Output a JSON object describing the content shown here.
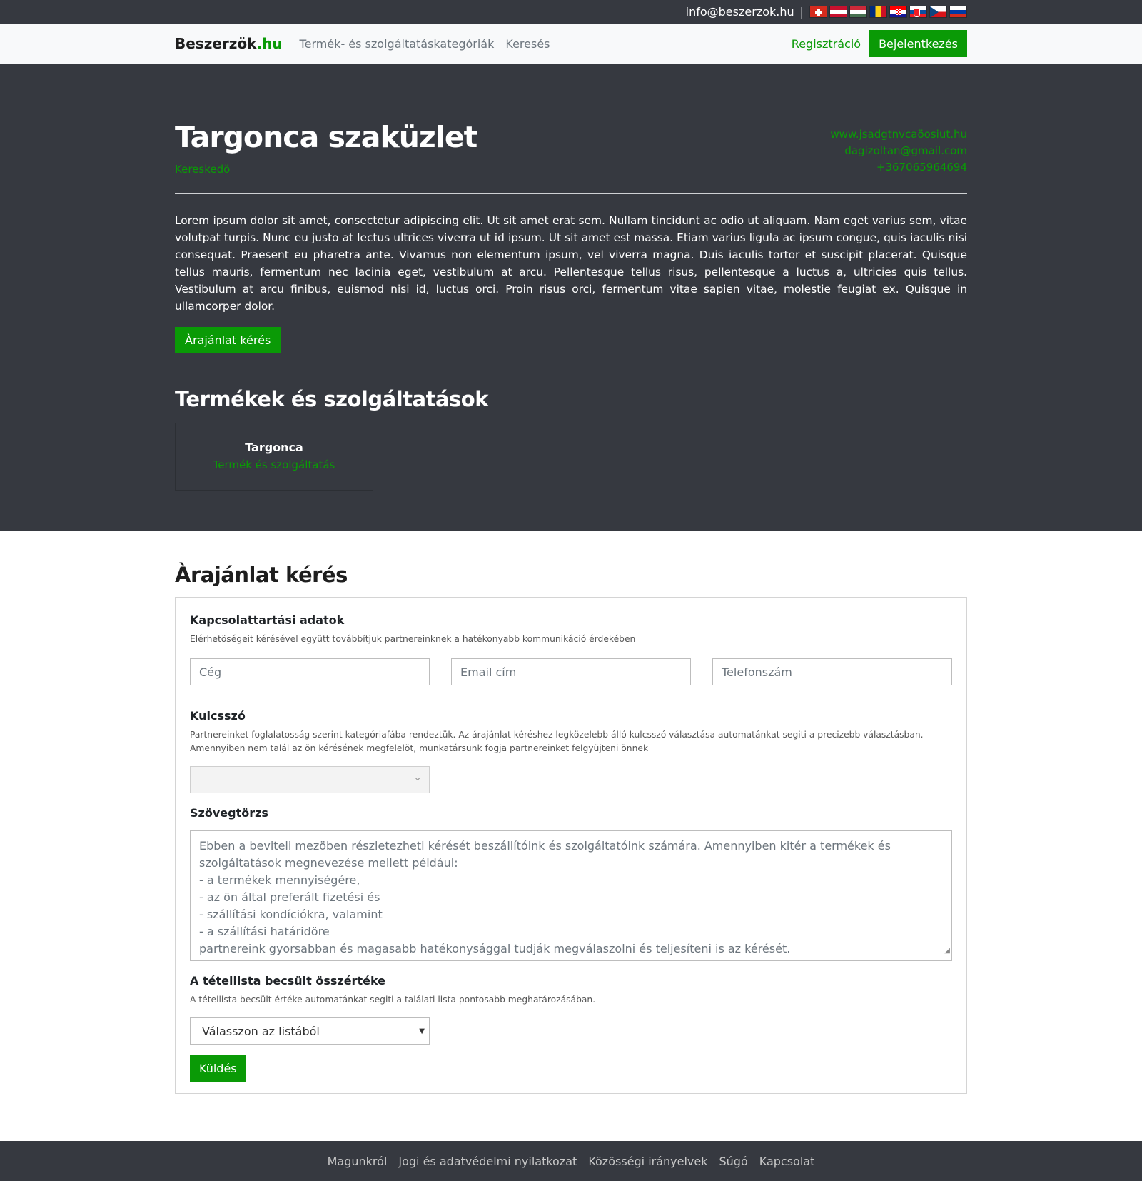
{
  "topbar": {
    "email": "info@beszerzok.hu",
    "separator": "|",
    "flags": [
      "swiss-flag-icon",
      "austria-flag-icon",
      "hungary-flag-icon",
      "romania-flag-icon",
      "croatia-flag-icon",
      "slovakia-flag-icon",
      "czech-flag-icon",
      "russia-flag-icon"
    ]
  },
  "navbar": {
    "brand_main": "Beszerzök",
    "brand_tld": ".hu",
    "links": [
      "Termék- és szolgáltatáskategóriák",
      "Keresés"
    ],
    "register": "Regisztráció",
    "login": "Bejelentkezés"
  },
  "company": {
    "name": "Targonca szaküzlet",
    "type": "Kereskedö",
    "website": "www.jsadgtnvcaöosiut.hu",
    "email": "dagizoltan@gmail.com",
    "phone": "+367065964694",
    "description": "Lorem ipsum dolor sit amet, consectetur adipiscing elit. Ut sit amet erat sem. Nullam tincidunt ac odio ut aliquam. Nam eget varius sem, vitae volutpat turpis. Nunc eu justo at lectus ultrices viverra ut id ipsum. Ut sit amet est massa. Etiam varius ligula ac ipsum congue, quis iaculis nisi consequat. Praesent eu pharetra ante. Vivamus non elementum ipsum, vel viverra magna. Duis iaculis tortor et suscipit placerat. Quisque tellus mauris, fermentum nec lacinia eget, vestibulum at arcu. Pellentesque tellus risus, pellentesque a luctus a, ultricies quis tellus. Vestibulum at arcu finibus, euismod nisi id, luctus orci. Proin risus orci, fermentum vitae sapien vitae, molestie feugiat ex. Quisque in ullamcorper dolor.",
    "quote_button": "Àrajánlat kérés"
  },
  "products": {
    "title": "Termékek és szolgáltatások",
    "items": [
      {
        "name": "Targonca",
        "category": "Termék és szolgáltatás"
      }
    ]
  },
  "form": {
    "title": "Àrajánlat kérés",
    "contact": {
      "label": "Kapcsolattartási adatok",
      "help": "Elérhetöségeit kérésével együtt továbbítjuk partnereinknek a hatékonyabb kommunikáció érdekében",
      "company_placeholder": "Cég",
      "email_placeholder": "Email cím",
      "phone_placeholder": "Telefonszám"
    },
    "keyword": {
      "label": "Kulcsszó",
      "help": "Partnereinket foglalatosság szerint kategóriafába rendeztük. Az árajánlat kéréshez legközelebb álló kulcsszó választása automatánkat segiti a precizebb választásban. Amennyiben nem talál az ön kérésének megfelelöt, munkatársunk fogja partnereinket felgyüjteni önnek",
      "value": ""
    },
    "body": {
      "label": "Szövegtörzs",
      "placeholder_lines": [
        "Ebben a beviteli mezöben részletezheti kérését beszállítóink és szolgáltatóink számára. Amennyiben kitér a termékek és szolgáltatások megnevezése mellett például:",
        "- a termékek mennyiségére,",
        "- az ön által preferált fizetési és",
        "- szállítási kondíciókra, valamint",
        "- a szállítási határidöre",
        "partnereink gyorsabban és magasabb hatékonysággal tudják megválaszolni és teljesíteni is az kérését."
      ]
    },
    "value": {
      "label": "A tétellista becsült összértéke",
      "help": "A tétellista becsült értéke automatánkat segiti a találati lista pontosabb meghatározásában.",
      "selected": "Válasszon az listából"
    },
    "submit": "Küldés"
  },
  "footer": {
    "links": [
      "Magunkról",
      "Jogi és adatvédelmi nyilatkozat",
      "Közösségi irányelvek",
      "Súgó",
      "Kapcsolat"
    ]
  }
}
